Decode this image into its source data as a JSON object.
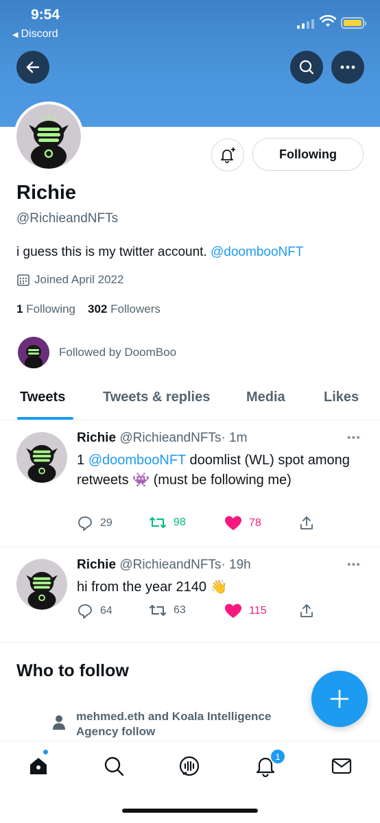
{
  "status_bar": {
    "time": "9:54",
    "back_app": "Discord"
  },
  "profile": {
    "name": "Richie",
    "handle": "@RichieandNFTs",
    "bio_text": "i guess this is my twitter account. ",
    "bio_mention": "@doombooNFT",
    "joined": "Joined April 2022",
    "following_count": "1",
    "following_label": "Following",
    "followers_count": "302",
    "followers_label": "Followers",
    "followed_by": "Followed by DoomBoo",
    "follow_button": "Following"
  },
  "tabs": [
    {
      "label": "Tweets",
      "active": true
    },
    {
      "label": "Tweets & replies",
      "active": false
    },
    {
      "label": "Media",
      "active": false
    },
    {
      "label": "Likes",
      "active": false
    }
  ],
  "tweets": [
    {
      "name": "Richie",
      "handle": "@RichieandNFTs",
      "time": "· 1m",
      "text_prefix": "1 ",
      "mention": "@doombooNFT",
      "text_suffix": " doomlist (WL) spot among retweets 👾 (must be following me)",
      "replies": "29",
      "retweets": "98",
      "likes": "78"
    },
    {
      "name": "Richie",
      "handle": "@RichieandNFTs",
      "time": "· 19h",
      "text": "hi from the year 2140 👋",
      "replies": "64",
      "retweets": "63",
      "likes": "115"
    }
  ],
  "who_to_follow": {
    "title": "Who to follow",
    "note": "mehmed.eth and Koala Intelligence Agency follow"
  },
  "bottom_nav": {
    "notifications_badge": "1"
  },
  "colors": {
    "accent": "#1d9bf0",
    "retweet": "#00ba7c",
    "like": "#f91880",
    "banner": "#4a94dc"
  },
  "icons": [
    "back-arrow-icon",
    "search-icon",
    "more-icon",
    "bell-plus-icon",
    "calendar-icon",
    "reply-icon",
    "retweet-icon",
    "heart-icon",
    "share-icon",
    "compose-plus-icon",
    "person-icon",
    "home-icon",
    "spaces-icon",
    "notifications-icon",
    "mail-icon"
  ]
}
